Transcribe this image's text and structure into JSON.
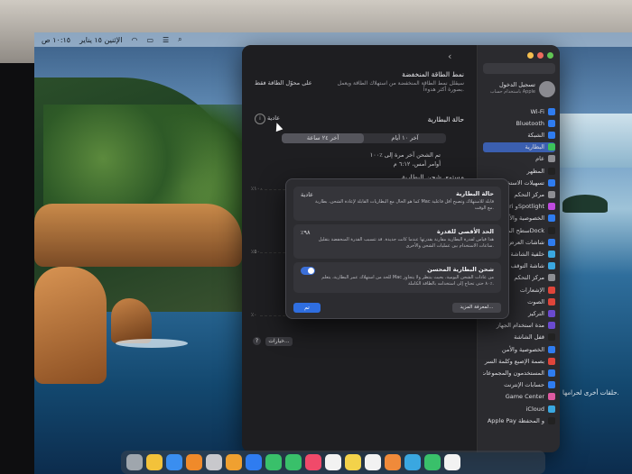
{
  "menubar": {
    "items": [
      "١٠:١٥ ص",
      "الإثنين ١٥ يناير"
    ]
  },
  "window": {
    "low_power_title": "نمط الطاقة المنخفضة",
    "low_power_desc": "سيقلل نمط الطاقة المنخفضة من استهلاك الطاقة ويعمل بصورة أكثر هدوءاً.",
    "low_power_value": "على محوّل الطاقة فقط",
    "battery_health_label": "حالة البطارية",
    "battery_health_value": "عادية",
    "range_tabs": [
      "آخر ٢٤ ساعة",
      "آخر ١٠ أيام"
    ],
    "last_charged": "تم الشحن آخر مرة إلى ٪١٠٠",
    "last_charged_time": "أوامر أمس، ٦:١٢ م",
    "charge_level_label": "مستوى شحن البطارية",
    "axis_labels": [
      "٪١٠٠",
      "٪٥٠",
      "٪٠"
    ],
    "options_button": "خيارات...",
    "help_button": "?"
  },
  "sidebar": {
    "items": [
      {
        "label": "Wi-Fi",
        "color": "#2f7cf0"
      },
      {
        "label": "Bluetooth",
        "color": "#2f7cf0"
      },
      {
        "label": "الشبكة",
        "color": "#2f7cf0"
      },
      {
        "label": "البطارية",
        "color": "#3cc25a",
        "active": true
      },
      {
        "label": "عام",
        "color": "#8e8e93"
      },
      {
        "label": "المظهر",
        "color": "#222"
      },
      {
        "label": "تسهيلات الاستخدام",
        "color": "#2f7cf0"
      },
      {
        "label": "مركز التحكم",
        "color": "#8e8e93"
      },
      {
        "label": "Siri وSpotlight",
        "color": "#c04adf"
      },
      {
        "label": "الخصوصية والأمن",
        "color": "#2f7cf0"
      },
      {
        "label": "سطح المكتب وDock",
        "color": "#222"
      },
      {
        "label": "شاشات العرض",
        "color": "#2f7cf0"
      },
      {
        "label": "خلفية الشاشة",
        "color": "#3aa7e0"
      },
      {
        "label": "شاشة التوقف",
        "color": "#3aa7e0"
      },
      {
        "label": "مركز التحكم",
        "color": "#8e8e93"
      },
      {
        "label": "الإشعارات",
        "color": "#e0453a"
      },
      {
        "label": "الصوت",
        "color": "#e0453a"
      },
      {
        "label": "التركيز",
        "color": "#6a4ad0"
      },
      {
        "label": "مدة استخدام الجهاز",
        "color": "#6a4ad0"
      },
      {
        "label": "قفل الشاشة",
        "color": "#222"
      },
      {
        "label": "الخصوصية والأمن",
        "color": "#2f7cf0"
      },
      {
        "label": "بصمة الإصبع وكلمة السر",
        "color": "#e0453a"
      },
      {
        "label": "المستخدمون والمجموعات",
        "color": "#2f7cf0"
      },
      {
        "label": "حسابات الإنترنت",
        "color": "#2f7cf0"
      },
      {
        "label": "Game Center",
        "color": "#e05aa0"
      },
      {
        "label": "iCloud",
        "color": "#3aa7e0"
      },
      {
        "label": "Apple Pay و المحفظة",
        "color": "#222"
      }
    ],
    "profile_name": "تسجيل الدخول",
    "profile_sub": "باستخدام حساب Apple"
  },
  "sheet": {
    "cards": [
      {
        "title": "حالة البطارية",
        "desc": "كما هو الحال مع البطاريات القابلة لإعادة الشحن، بطارية Mac قابلة للاستهلاك وتصبح أقل فاعلية مع الوقت.",
        "value": "عادية"
      },
      {
        "title": "الحد الأقصى للقدرة",
        "desc": "هذا قياس لقدرة البطارية مقارنة بقدرتها عندما كانت جديدة. قد تتسبب القدرة المنخفضة بتقليل ساعات الاستخدام بين عمليات الشحن والأخرى.",
        "value": "٪٩٨"
      },
      {
        "title": "شحن البطارية المحسن",
        "desc": "للحد من استهلاك عمر البطارية، يتعلم Mac من عادات الشحن اليومية، بحيث ينتظر ولا يتجاوز ٪٨٠ حتى تحتاج إلى استخدامه بالطاقة الكاملة.",
        "toggle": true
      }
    ],
    "learn_more": "لمعرفة المزيد...",
    "done": "تم"
  },
  "desktop": {
    "caption": "حلقات أخرى لحرامها."
  },
  "watermark": "حراج"
}
